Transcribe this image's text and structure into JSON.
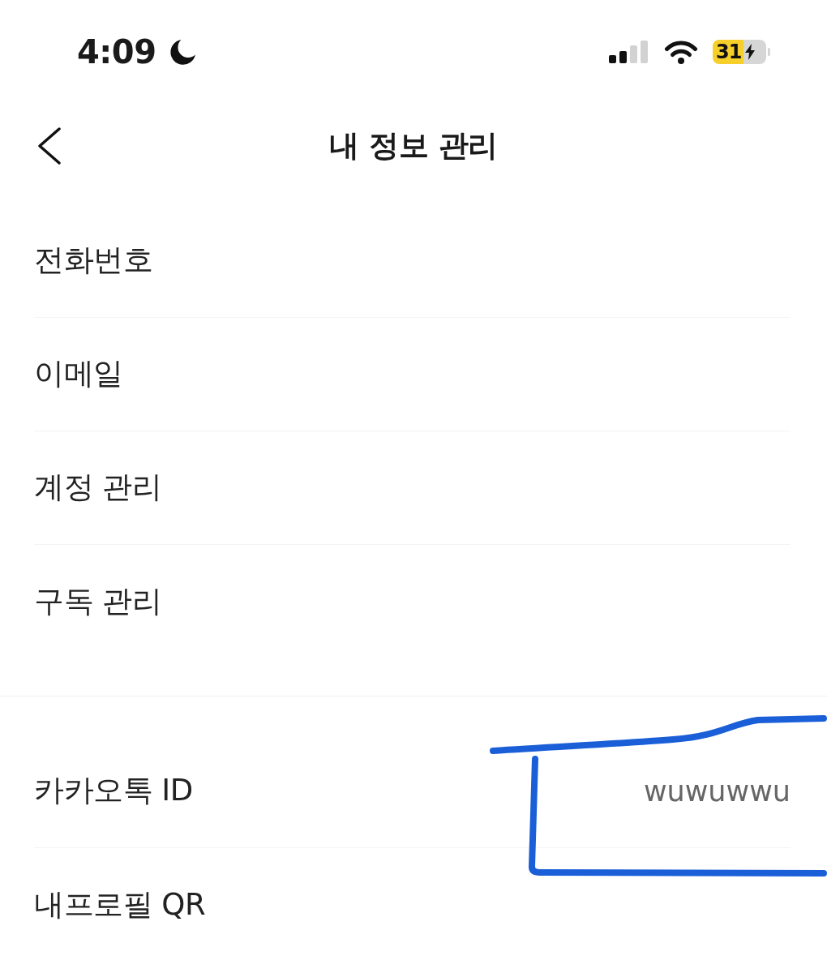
{
  "status_bar": {
    "time": "4:09",
    "battery_percent": "31"
  },
  "header": {
    "title": "내 정보 관리"
  },
  "sections": [
    {
      "items": [
        {
          "label": "전화번호"
        },
        {
          "label": "이메일"
        },
        {
          "label": "계정 관리"
        },
        {
          "label": "구독 관리"
        }
      ]
    },
    {
      "items": [
        {
          "label": "카카오톡 ID",
          "value": "wuwuwwu"
        },
        {
          "label": "내프로필 QR"
        }
      ]
    }
  ]
}
